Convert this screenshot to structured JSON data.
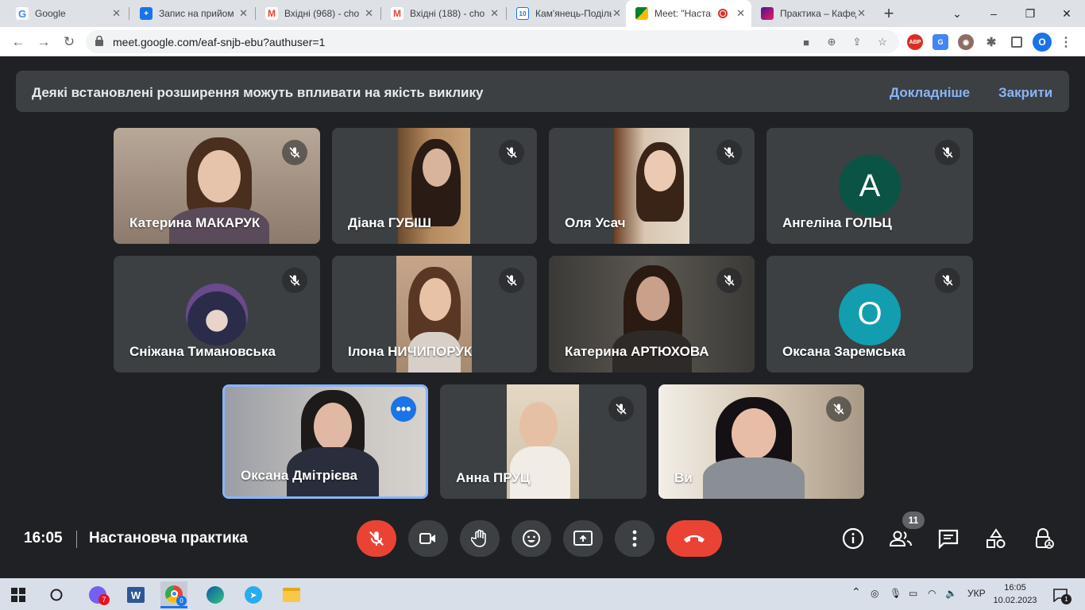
{
  "browser": {
    "tabs": [
      {
        "title": "Google",
        "favicon": "google-icon",
        "active": false
      },
      {
        "title": "Запис на прийом",
        "favicon": "plus-icon",
        "active": false
      },
      {
        "title": "Вхідні (968) - cho",
        "favicon": "gmail-icon",
        "active": false
      },
      {
        "title": "Вхідні (188) - cho",
        "favicon": "gmail-icon",
        "active": false
      },
      {
        "title": "Кам'янець-Подільськ",
        "favicon": "calendar-icon",
        "favicon_text": "10",
        "active": false
      },
      {
        "title": "Meet: \"Настановча",
        "favicon": "meet-icon",
        "active": true
      },
      {
        "title": "Практика – Кафедра",
        "favicon": "site-icon",
        "active": false
      }
    ],
    "url": "meet.google.com/eaf-snjb-ebu?authuser=1",
    "extensions": {
      "adblock": "ABP",
      "profile_initial": "O"
    }
  },
  "banner": {
    "message": "Деякі встановлені розширення можуть впливати на якість виклику",
    "more_label": "Докладніше",
    "close_label": "Закрити"
  },
  "participants": [
    {
      "name": "Катерина МАКАРУК",
      "muted": true
    },
    {
      "name": "Діана ГУБІШ",
      "muted": true
    },
    {
      "name": "Оля Усач",
      "muted": true
    },
    {
      "name": "Ангеліна ГОЛЬЦ",
      "muted": true,
      "avatar_letter": "A",
      "avatar_color": "#0b5345"
    },
    {
      "name": "Сніжана Тимановська",
      "muted": true
    },
    {
      "name": "Ілона НИЧИПОРУК",
      "muted": true
    },
    {
      "name": "Катерина АРТЮХОВА",
      "muted": true
    },
    {
      "name": "Оксана Заремська",
      "muted": true,
      "avatar_letter": "O",
      "avatar_color": "#129eaf"
    },
    {
      "name": "Оксана Дмітрієва",
      "muted": false,
      "speaking": true
    },
    {
      "name": "Анна ПРУЦ",
      "muted": true
    },
    {
      "name": "Ви",
      "muted": true
    }
  ],
  "meeting": {
    "time": "16:05",
    "title": "Настановча практика",
    "participant_count": "11"
  },
  "colors": {
    "end_call": "#ea4335",
    "muted_btn": "#ea4335",
    "accent": "#8ab4f8",
    "speaking_border": "#8ab4f8"
  },
  "taskbar": {
    "viber_badge": "7",
    "chrome_badge": "0",
    "language": "УКР",
    "time": "16:05",
    "date": "10.02.2023",
    "notifications": "1"
  }
}
